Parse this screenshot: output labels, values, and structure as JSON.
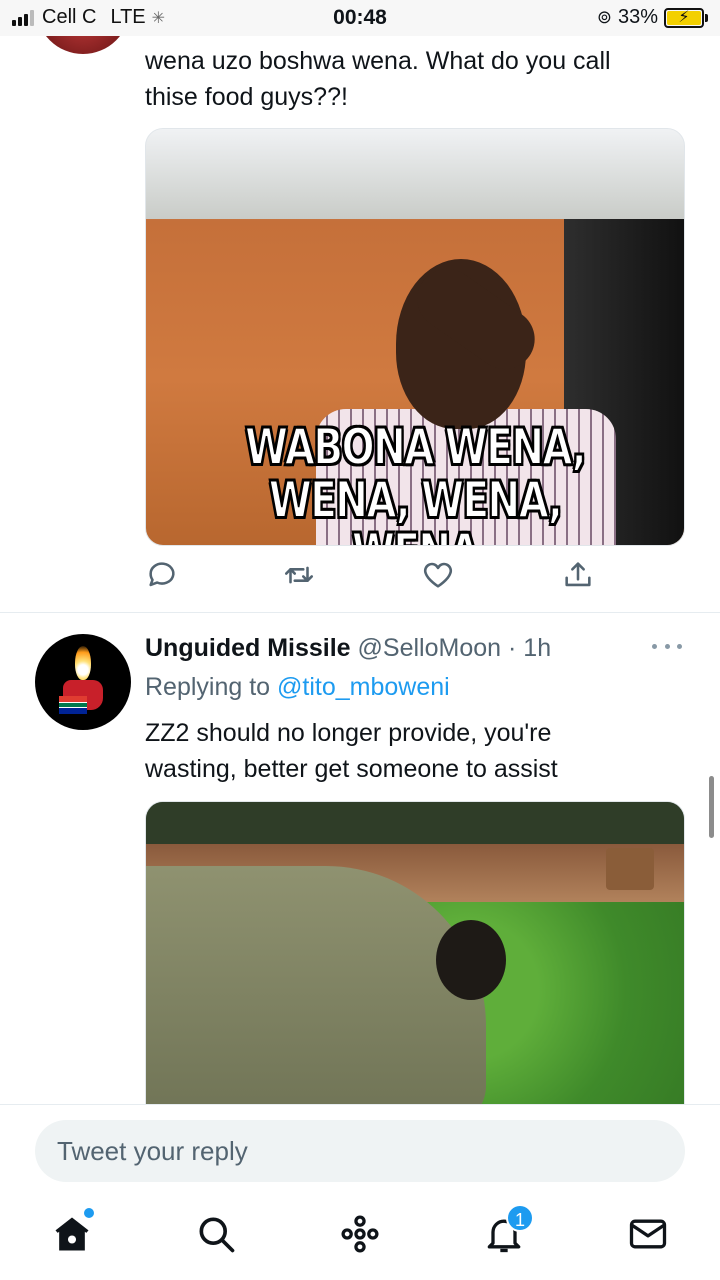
{
  "status_bar": {
    "carrier": "Cell C",
    "network": "LTE",
    "time": "00:48",
    "battery_percent": "33%",
    "battery_level": 0.33
  },
  "tweet1": {
    "text_line1": "wena uzo boshwa wena. What do you call",
    "text_line2": "thise food guys??!",
    "media_caption_line1": "WABONA WENA,",
    "media_caption_line2": "WENA, WENA, WENA"
  },
  "tweet2": {
    "display_name": "Unguided Missile",
    "handle": "@SelloMoon",
    "time": "· 1h",
    "replying_prefix": "Replying to ",
    "replying_to": "@tito_mboweni",
    "text_line1": "ZZ2 should no longer provide, you're",
    "text_line2": "wasting, better get someone to assist"
  },
  "reply": {
    "placeholder": "Tweet your reply"
  },
  "nav": {
    "notifications_count": "1"
  },
  "icons": {
    "reply": "comment-icon",
    "retweet": "retweet-icon",
    "like": "heart-icon",
    "share": "share-icon",
    "home": "home-icon",
    "search": "search-icon",
    "spaces": "spaces-icon",
    "notifications": "bell-icon",
    "messages": "mail-icon"
  },
  "colors": {
    "accent": "#1d9bf0",
    "secondary_text": "#536471"
  }
}
